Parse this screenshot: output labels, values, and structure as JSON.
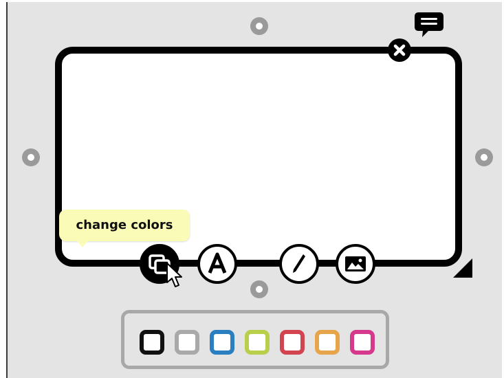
{
  "tooltip": {
    "text": "change colors"
  },
  "icons": {
    "comment": "speech-bubble-icon",
    "close": "close-x-icon",
    "change_colors": "color-swap-icon",
    "text": "letter-a-icon",
    "draw": "pencil-icon",
    "image": "image-icon",
    "resize": "resize-corner-icon",
    "cursor": "mouse-pointer-icon"
  },
  "palette": {
    "swatches": [
      {
        "name": "black",
        "color": "#111111"
      },
      {
        "name": "gray",
        "color": "#a9a9a9"
      },
      {
        "name": "blue",
        "color": "#2a7fc1"
      },
      {
        "name": "lime",
        "color": "#b7cf4a"
      },
      {
        "name": "red",
        "color": "#d2444f"
      },
      {
        "name": "orange",
        "color": "#e6a54a"
      },
      {
        "name": "pink",
        "color": "#d6388c"
      }
    ]
  },
  "colors": {
    "background": "#e4e4e4",
    "card_border": "#000000",
    "handle": "#9a9a9a",
    "tooltip": "#fbfbb8"
  }
}
